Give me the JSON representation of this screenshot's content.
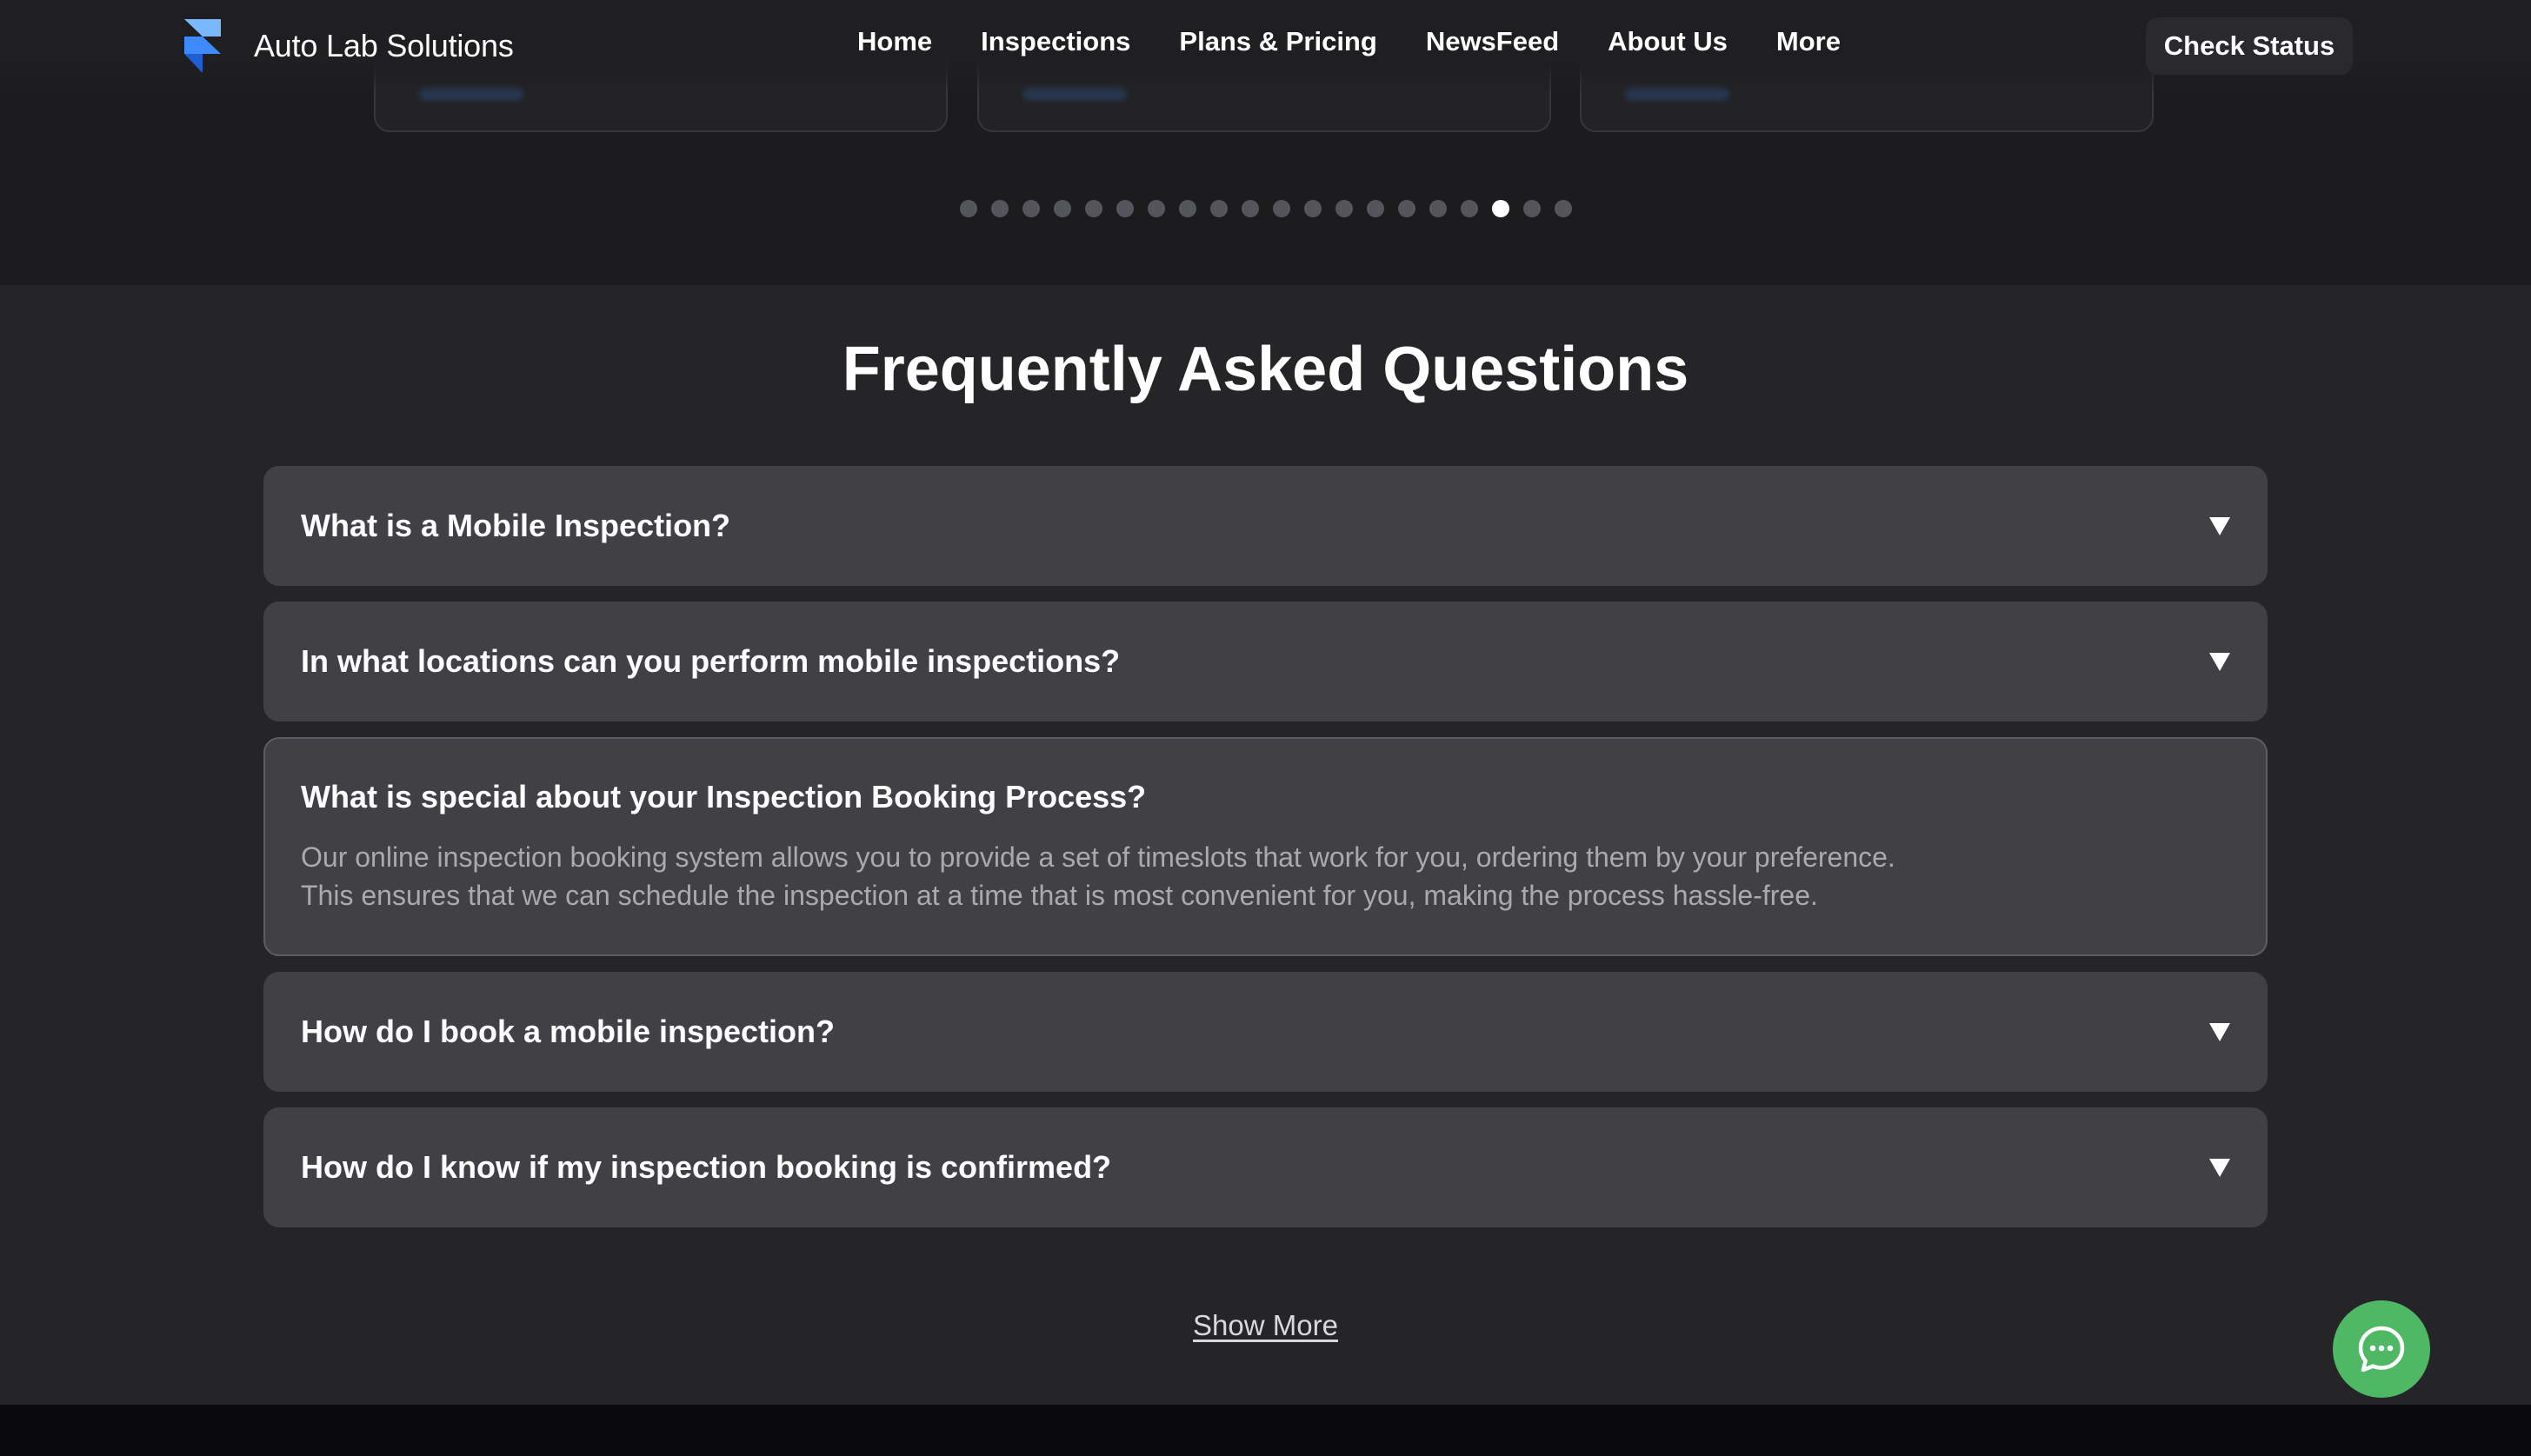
{
  "brand": {
    "name": "Auto Lab Solutions",
    "logo_icon": "framer-logo-icon",
    "logo_colors": [
      "#7ab8ff",
      "#3d8bff",
      "#1f5fd6"
    ]
  },
  "nav": {
    "links": [
      {
        "label": "Home"
      },
      {
        "label": "Inspections"
      },
      {
        "label": "Plans & Pricing"
      },
      {
        "label": "NewsFeed"
      },
      {
        "label": "About Us"
      },
      {
        "label": "More"
      }
    ],
    "cta_label": "Check Status"
  },
  "carousel": {
    "total_slides": 20,
    "active_index": 17
  },
  "faq": {
    "title": "Frequently Asked Questions",
    "items": [
      {
        "question": "What is a Mobile Inspection?",
        "open": false
      },
      {
        "question": "In what locations can you perform mobile inspections?",
        "open": false
      },
      {
        "question": "What is special about your Inspection Booking Process?",
        "open": true,
        "answer_line1": "Our online inspection booking system allows you to provide a set of timeslots that work for you, ordering them by your preference.",
        "answer_line2": "This ensures that we can schedule the inspection at a time that is most convenient for you, making the process hassle-free."
      },
      {
        "question": "How do I book a mobile inspection?",
        "open": false
      },
      {
        "question": "How do I know if my inspection booking is confirmed?",
        "open": false
      }
    ],
    "expand_icon": "triangle-down-icon",
    "show_more_label": "Show More"
  },
  "chat": {
    "icon": "chat-bubble-icon",
    "color": "#4eb865"
  },
  "colors": {
    "band_top": "#1c1c1f",
    "section_bg": "#252528",
    "item_bg": "#404045",
    "answer_text": "#a9a9ae"
  }
}
